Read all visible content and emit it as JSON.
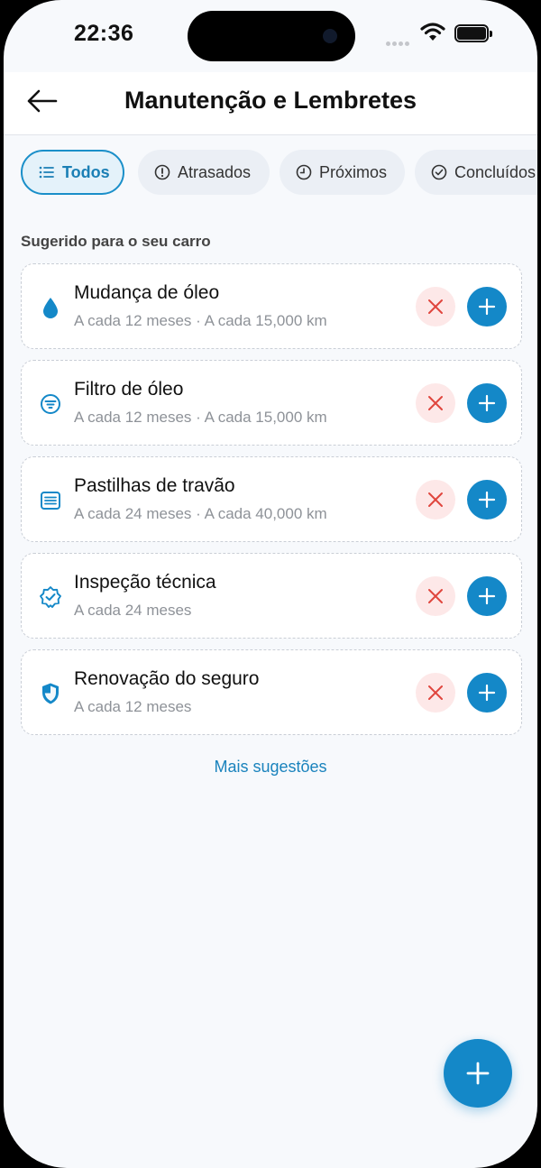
{
  "status": {
    "time": "22:36"
  },
  "header": {
    "title": "Manutenção e Lembretes"
  },
  "filters": [
    {
      "label": "Todos",
      "icon": "list-icon",
      "active": true
    },
    {
      "label": "Atrasados",
      "icon": "alert-circle-icon",
      "active": false
    },
    {
      "label": "Próximos",
      "icon": "clock-icon",
      "active": false
    },
    {
      "label": "Concluídos",
      "icon": "check-circle-icon",
      "active": false
    }
  ],
  "section_label": "Sugerido para o seu carro",
  "suggestions": [
    {
      "title": "Mudança de óleo",
      "subtitle": "A cada 12 meses · A cada 15,000 km",
      "icon": "droplet-icon"
    },
    {
      "title": "Filtro de óleo",
      "subtitle": "A cada 12 meses · A cada 15,000 km",
      "icon": "filter-icon"
    },
    {
      "title": "Pastilhas de travão",
      "subtitle": "A cada 24 meses · A cada 40,000 km",
      "icon": "brake-pad-icon"
    },
    {
      "title": "Inspeção técnica",
      "subtitle": "A cada 24 meses",
      "icon": "verified-badge-icon"
    },
    {
      "title": "Renovação do seguro",
      "subtitle": "A cada 12 meses",
      "icon": "shield-icon"
    }
  ],
  "more_link": "Mais sugestões",
  "colors": {
    "accent": "#1488c8",
    "dismiss_bg": "#fde8e8",
    "dismiss_icon": "#e0453d",
    "background": "#f7f9fc"
  }
}
